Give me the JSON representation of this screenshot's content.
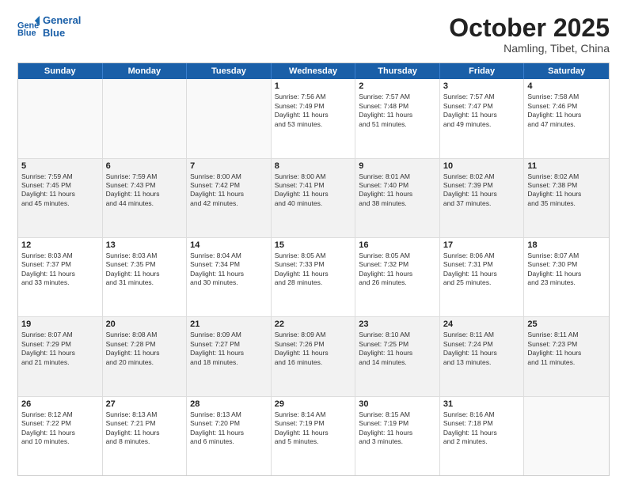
{
  "header": {
    "logo_general": "General",
    "logo_blue": "Blue",
    "month": "October 2025",
    "location": "Namling, Tibet, China"
  },
  "weekdays": [
    "Sunday",
    "Monday",
    "Tuesday",
    "Wednesday",
    "Thursday",
    "Friday",
    "Saturday"
  ],
  "rows": [
    [
      {
        "day": "",
        "text": ""
      },
      {
        "day": "",
        "text": ""
      },
      {
        "day": "",
        "text": ""
      },
      {
        "day": "1",
        "text": "Sunrise: 7:56 AM\nSunset: 7:49 PM\nDaylight: 11 hours\nand 53 minutes."
      },
      {
        "day": "2",
        "text": "Sunrise: 7:57 AM\nSunset: 7:48 PM\nDaylight: 11 hours\nand 51 minutes."
      },
      {
        "day": "3",
        "text": "Sunrise: 7:57 AM\nSunset: 7:47 PM\nDaylight: 11 hours\nand 49 minutes."
      },
      {
        "day": "4",
        "text": "Sunrise: 7:58 AM\nSunset: 7:46 PM\nDaylight: 11 hours\nand 47 minutes."
      }
    ],
    [
      {
        "day": "5",
        "text": "Sunrise: 7:59 AM\nSunset: 7:45 PM\nDaylight: 11 hours\nand 45 minutes."
      },
      {
        "day": "6",
        "text": "Sunrise: 7:59 AM\nSunset: 7:43 PM\nDaylight: 11 hours\nand 44 minutes."
      },
      {
        "day": "7",
        "text": "Sunrise: 8:00 AM\nSunset: 7:42 PM\nDaylight: 11 hours\nand 42 minutes."
      },
      {
        "day": "8",
        "text": "Sunrise: 8:00 AM\nSunset: 7:41 PM\nDaylight: 11 hours\nand 40 minutes."
      },
      {
        "day": "9",
        "text": "Sunrise: 8:01 AM\nSunset: 7:40 PM\nDaylight: 11 hours\nand 38 minutes."
      },
      {
        "day": "10",
        "text": "Sunrise: 8:02 AM\nSunset: 7:39 PM\nDaylight: 11 hours\nand 37 minutes."
      },
      {
        "day": "11",
        "text": "Sunrise: 8:02 AM\nSunset: 7:38 PM\nDaylight: 11 hours\nand 35 minutes."
      }
    ],
    [
      {
        "day": "12",
        "text": "Sunrise: 8:03 AM\nSunset: 7:37 PM\nDaylight: 11 hours\nand 33 minutes."
      },
      {
        "day": "13",
        "text": "Sunrise: 8:03 AM\nSunset: 7:35 PM\nDaylight: 11 hours\nand 31 minutes."
      },
      {
        "day": "14",
        "text": "Sunrise: 8:04 AM\nSunset: 7:34 PM\nDaylight: 11 hours\nand 30 minutes."
      },
      {
        "day": "15",
        "text": "Sunrise: 8:05 AM\nSunset: 7:33 PM\nDaylight: 11 hours\nand 28 minutes."
      },
      {
        "day": "16",
        "text": "Sunrise: 8:05 AM\nSunset: 7:32 PM\nDaylight: 11 hours\nand 26 minutes."
      },
      {
        "day": "17",
        "text": "Sunrise: 8:06 AM\nSunset: 7:31 PM\nDaylight: 11 hours\nand 25 minutes."
      },
      {
        "day": "18",
        "text": "Sunrise: 8:07 AM\nSunset: 7:30 PM\nDaylight: 11 hours\nand 23 minutes."
      }
    ],
    [
      {
        "day": "19",
        "text": "Sunrise: 8:07 AM\nSunset: 7:29 PM\nDaylight: 11 hours\nand 21 minutes."
      },
      {
        "day": "20",
        "text": "Sunrise: 8:08 AM\nSunset: 7:28 PM\nDaylight: 11 hours\nand 20 minutes."
      },
      {
        "day": "21",
        "text": "Sunrise: 8:09 AM\nSunset: 7:27 PM\nDaylight: 11 hours\nand 18 minutes."
      },
      {
        "day": "22",
        "text": "Sunrise: 8:09 AM\nSunset: 7:26 PM\nDaylight: 11 hours\nand 16 minutes."
      },
      {
        "day": "23",
        "text": "Sunrise: 8:10 AM\nSunset: 7:25 PM\nDaylight: 11 hours\nand 14 minutes."
      },
      {
        "day": "24",
        "text": "Sunrise: 8:11 AM\nSunset: 7:24 PM\nDaylight: 11 hours\nand 13 minutes."
      },
      {
        "day": "25",
        "text": "Sunrise: 8:11 AM\nSunset: 7:23 PM\nDaylight: 11 hours\nand 11 minutes."
      }
    ],
    [
      {
        "day": "26",
        "text": "Sunrise: 8:12 AM\nSunset: 7:22 PM\nDaylight: 11 hours\nand 10 minutes."
      },
      {
        "day": "27",
        "text": "Sunrise: 8:13 AM\nSunset: 7:21 PM\nDaylight: 11 hours\nand 8 minutes."
      },
      {
        "day": "28",
        "text": "Sunrise: 8:13 AM\nSunset: 7:20 PM\nDaylight: 11 hours\nand 6 minutes."
      },
      {
        "day": "29",
        "text": "Sunrise: 8:14 AM\nSunset: 7:19 PM\nDaylight: 11 hours\nand 5 minutes."
      },
      {
        "day": "30",
        "text": "Sunrise: 8:15 AM\nSunset: 7:19 PM\nDaylight: 11 hours\nand 3 minutes."
      },
      {
        "day": "31",
        "text": "Sunrise: 8:16 AM\nSunset: 7:18 PM\nDaylight: 11 hours\nand 2 minutes."
      },
      {
        "day": "",
        "text": ""
      }
    ]
  ]
}
